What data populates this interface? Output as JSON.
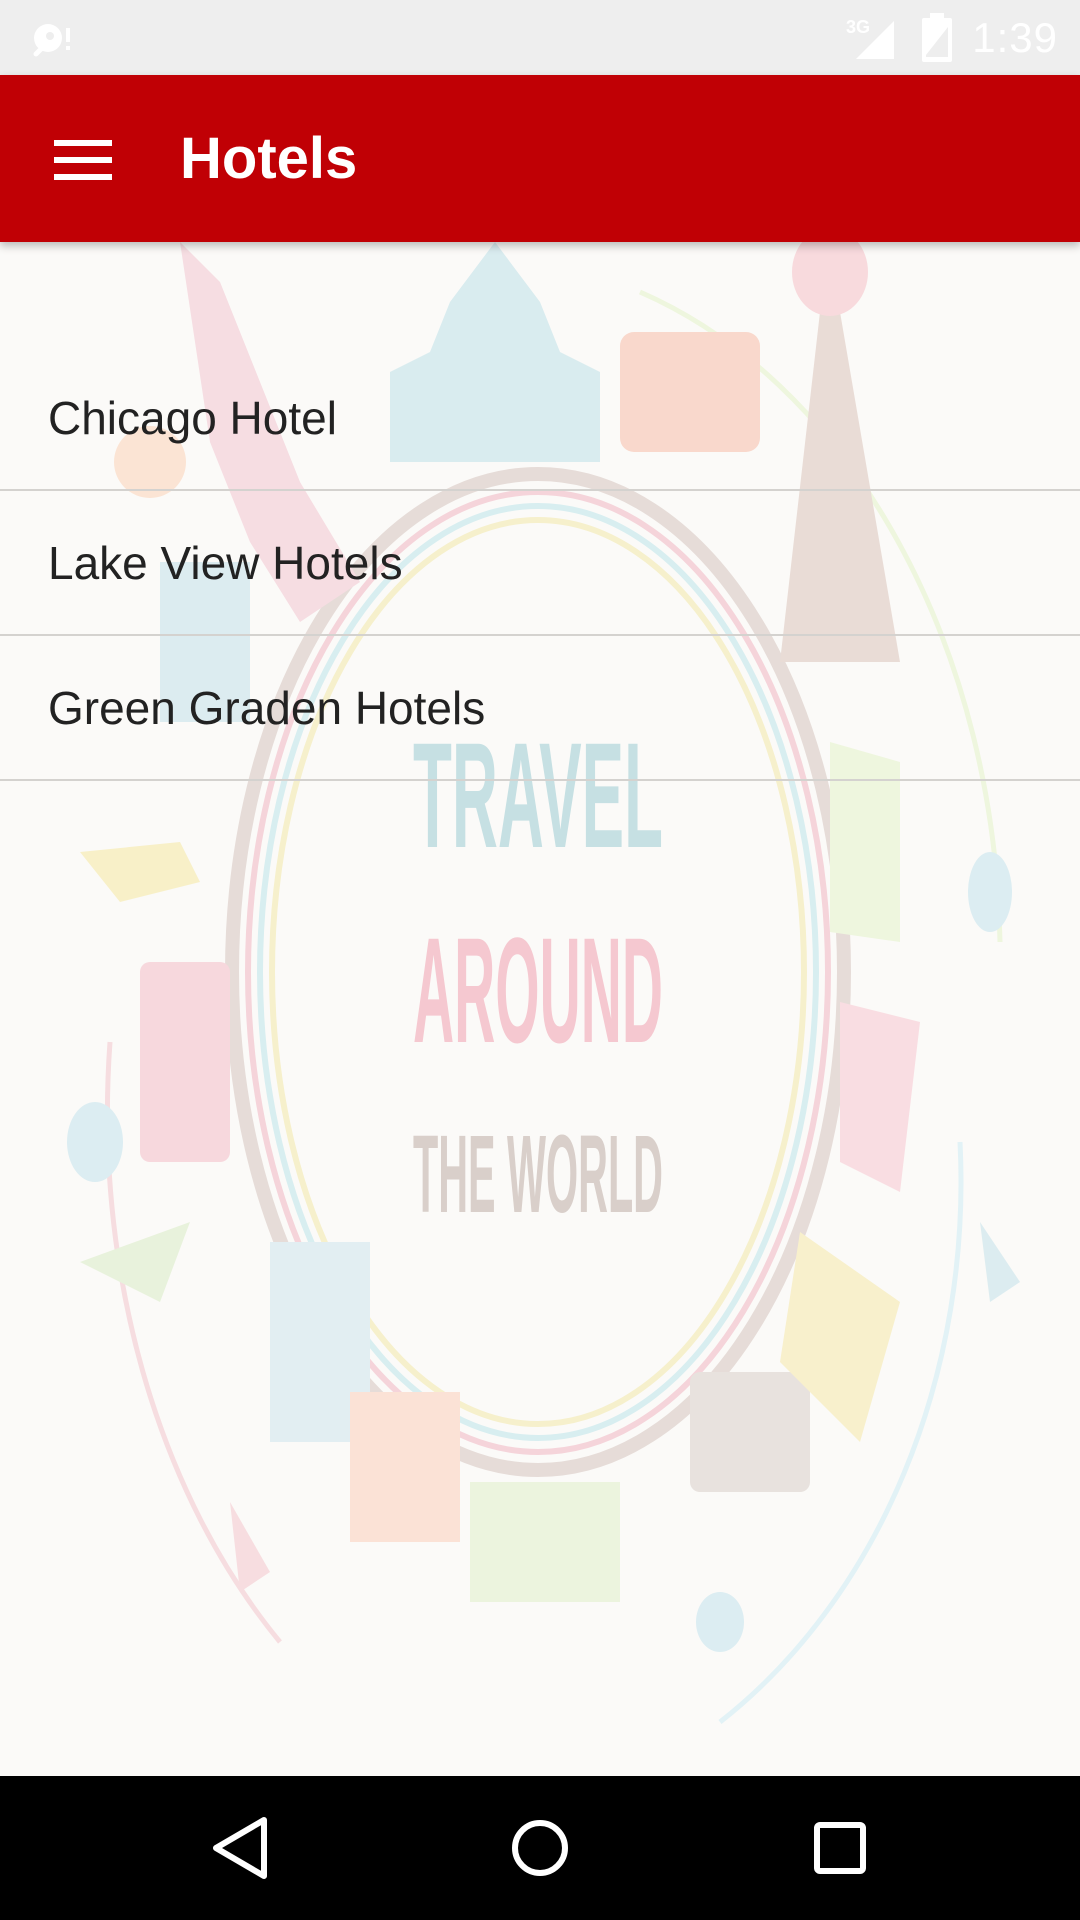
{
  "status_bar": {
    "time": "1:39",
    "network": "3G",
    "icons": [
      "notification-icon",
      "signal-icon",
      "battery-icon"
    ]
  },
  "app_bar": {
    "title": "Hotels",
    "menu_icon": "hamburger-menu-icon",
    "color": "#c00005"
  },
  "hotels": [
    {
      "name": "Chicago Hotel"
    },
    {
      "name": "Lake View Hotels"
    },
    {
      "name": "Green Graden Hotels"
    }
  ],
  "background": {
    "line1": "TRAVEL",
    "line2": "AROUND",
    "line3": "THE WORLD"
  },
  "nav_bar": {
    "icons": [
      "back-icon",
      "home-icon",
      "recents-icon"
    ]
  }
}
